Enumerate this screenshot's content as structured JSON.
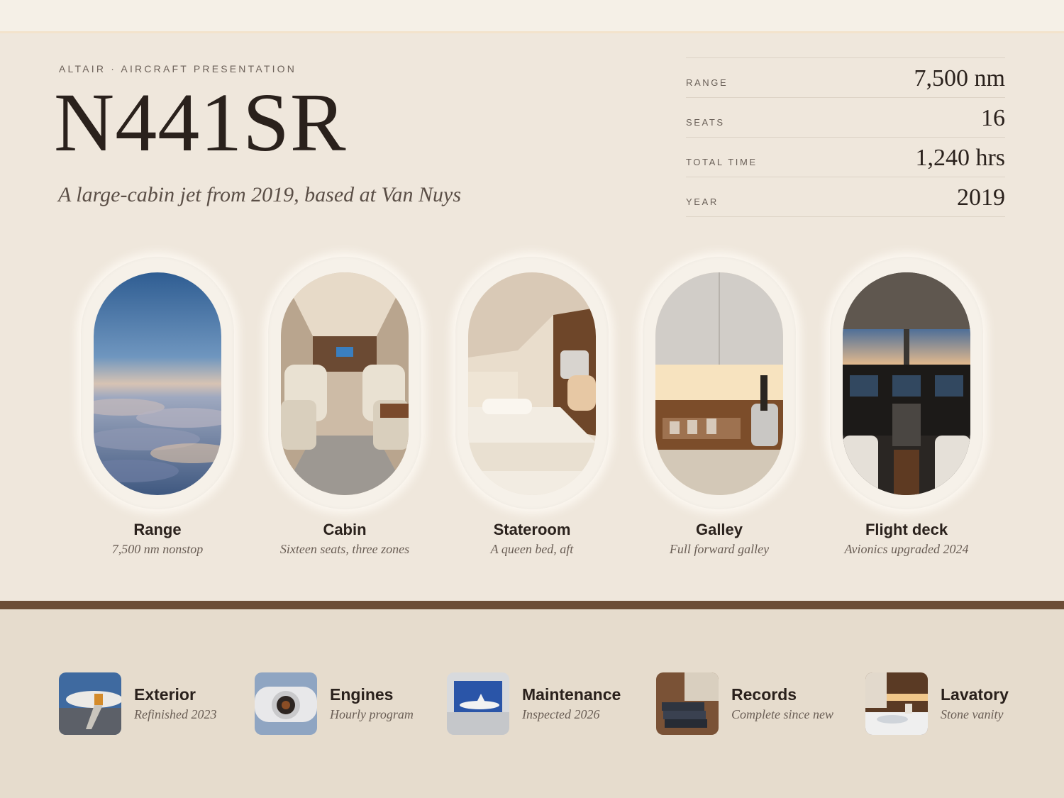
{
  "header": {
    "eyebrow": "ALTAIR · AIRCRAFT PRESENTATION",
    "tail_number": "N441SR",
    "subtitle": "A large-cabin jet from 2019, based at Van Nuys"
  },
  "specs": [
    {
      "label": "RANGE",
      "value": "7,500 nm"
    },
    {
      "label": "SEATS",
      "value": "16"
    },
    {
      "label": "TOTAL TIME",
      "value": "1,240 hrs"
    },
    {
      "label": "YEAR",
      "value": "2019"
    }
  ],
  "windows": [
    {
      "title": "Range",
      "caption": "7,500 nm nonstop",
      "image": "sky-above-clouds"
    },
    {
      "title": "Cabin",
      "caption": "Sixteen seats, three zones",
      "image": "cabin-interior"
    },
    {
      "title": "Stateroom",
      "caption": "A queen bed, aft",
      "image": "stateroom-bed"
    },
    {
      "title": "Galley",
      "caption": "Full forward galley",
      "image": "galley-counter"
    },
    {
      "title": "Flight deck",
      "caption": "Avionics upgraded 2024",
      "image": "cockpit"
    }
  ],
  "features": [
    {
      "title": "Exterior",
      "caption": "Refinished 2023",
      "image": "jet-exterior"
    },
    {
      "title": "Engines",
      "caption": "Hourly program",
      "image": "engine-nacelle"
    },
    {
      "title": "Maintenance",
      "caption": "Inspected 2026",
      "image": "hangar"
    },
    {
      "title": "Records",
      "caption": "Complete since new",
      "image": "logbooks"
    },
    {
      "title": "Lavatory",
      "caption": "Stone vanity",
      "image": "lavatory-sink"
    }
  ],
  "colors": {
    "background": "#efe7dc",
    "lower_band": "#e6dccd",
    "divider": "#6c4d36",
    "ink": "#2a211c"
  }
}
